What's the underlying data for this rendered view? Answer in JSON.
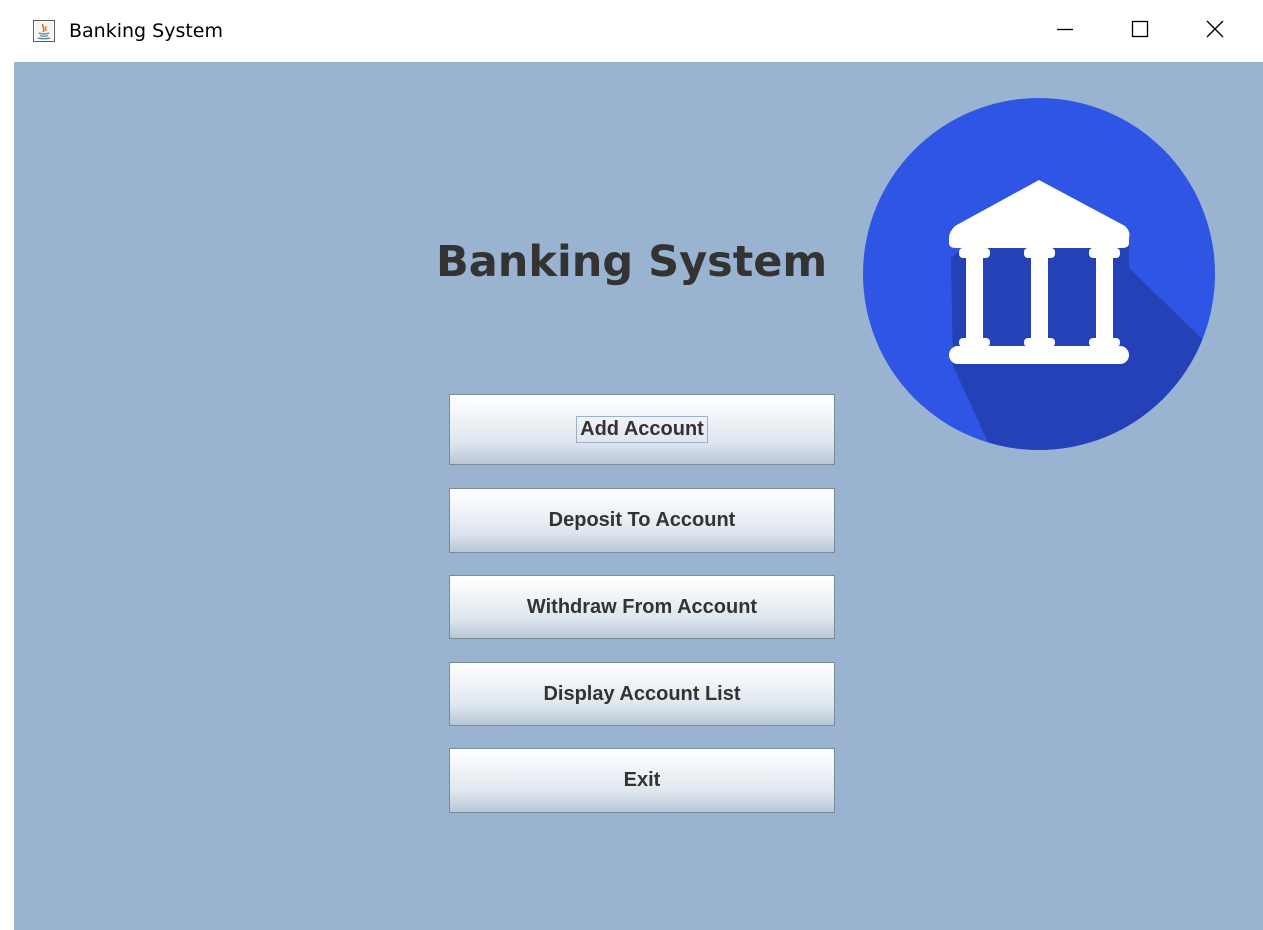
{
  "window": {
    "title": "Banking System",
    "controls": {
      "minimize_icon": "minimize-icon",
      "maximize_icon": "maximize-icon",
      "close_icon": "close-icon"
    }
  },
  "main": {
    "heading": "Banking System",
    "logo_icon": "bank-icon",
    "buttons": [
      {
        "label": "Add Account",
        "focused": true
      },
      {
        "label": "Deposit To Account"
      },
      {
        "label": "Withdraw From Account"
      },
      {
        "label": "Display Account List"
      },
      {
        "label": "Exit"
      }
    ]
  },
  "colors": {
    "background": "#99b3d0",
    "logo_circle": "#2f55e4",
    "logo_shadow": "#2541b8",
    "heading_text": "#333333"
  }
}
